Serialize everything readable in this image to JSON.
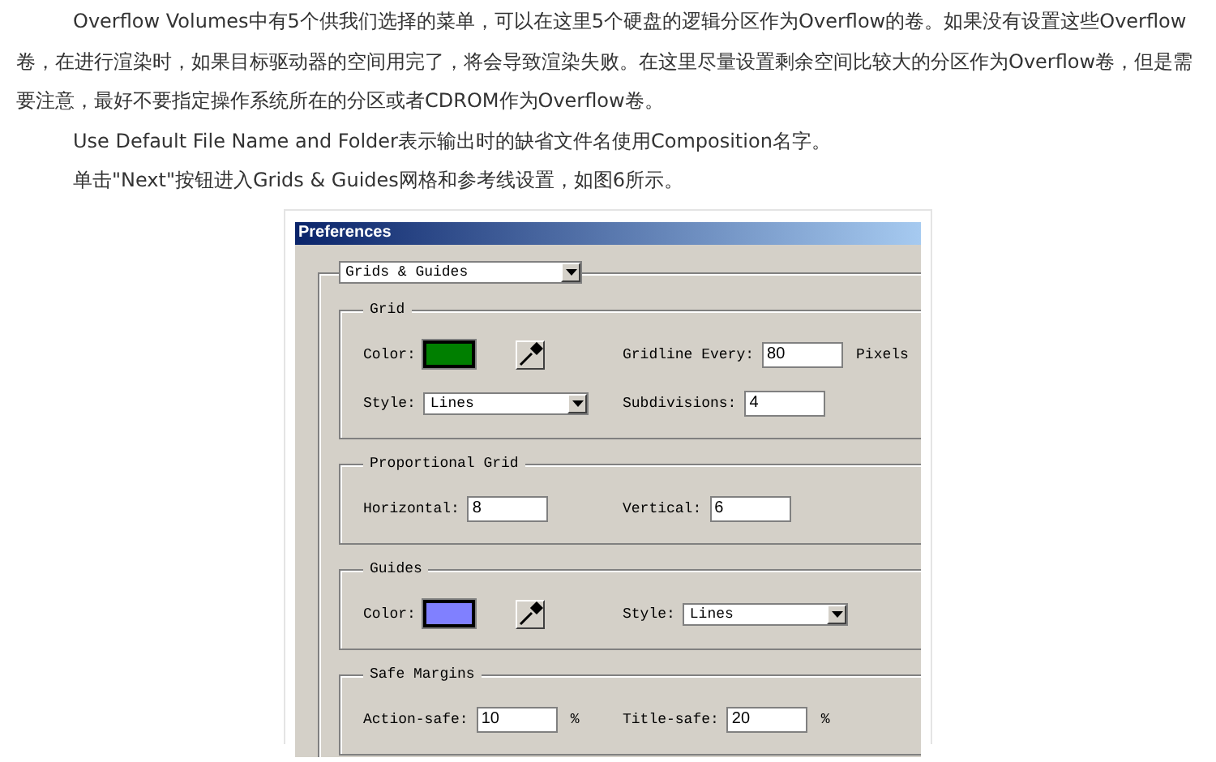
{
  "article": {
    "paragraphs": [
      "Overflow Volumes中有5个供我们选择的菜单，可以在这里5个硬盘的逻辑分区作为Overflow的卷。如果没有设置这些Overflow卷，在进行渲染时，如果目标驱动器的空间用完了，将会导致渲染失败。在这里尽量设置剩余空间比较大的分区作为Overflow卷，但是需要注意，最好不要指定操作系统所在的分区或者CDROM作为Overflow卷。",
      "Use Default File Name and Folder表示输出时的缺省文件名使用Composition名字。",
      "单击\"Next\"按钮进入Grids & Guides网格和参考线设置，如图6所示。"
    ]
  },
  "dialog": {
    "title": "Preferences",
    "category": "Grids & Guides",
    "sections": [
      {
        "title": "Grid",
        "rows": [
          [
            {
              "kind": "color",
              "label": "Color:",
              "color": "#007f00"
            },
            {
              "kind": "text",
              "label": "Gridline Every:",
              "value": "80",
              "suffix": "Pixels"
            }
          ],
          [
            {
              "kind": "select",
              "label": "Style:",
              "value": "Lines"
            },
            {
              "kind": "text",
              "label": "Subdivisions:",
              "value": "4"
            }
          ]
        ]
      },
      {
        "title": "Proportional Grid",
        "rows": [
          [
            {
              "kind": "text",
              "label": "Horizontal:",
              "value": "8"
            },
            {
              "kind": "text",
              "label": "Vertical:",
              "value": "6"
            }
          ]
        ]
      },
      {
        "title": "Guides",
        "rows": [
          [
            {
              "kind": "color",
              "label": "Color:",
              "color": "#8080ff"
            },
            {
              "kind": "select",
              "label": "Style:",
              "value": "Lines"
            }
          ]
        ]
      },
      {
        "title": "Safe Margins",
        "rows": [
          [
            {
              "kind": "text",
              "label": "Action-safe:",
              "value": "10",
              "suffix": "%"
            },
            {
              "kind": "text",
              "label": "Title-safe:",
              "value": "20",
              "suffix": "%"
            }
          ]
        ]
      }
    ]
  }
}
